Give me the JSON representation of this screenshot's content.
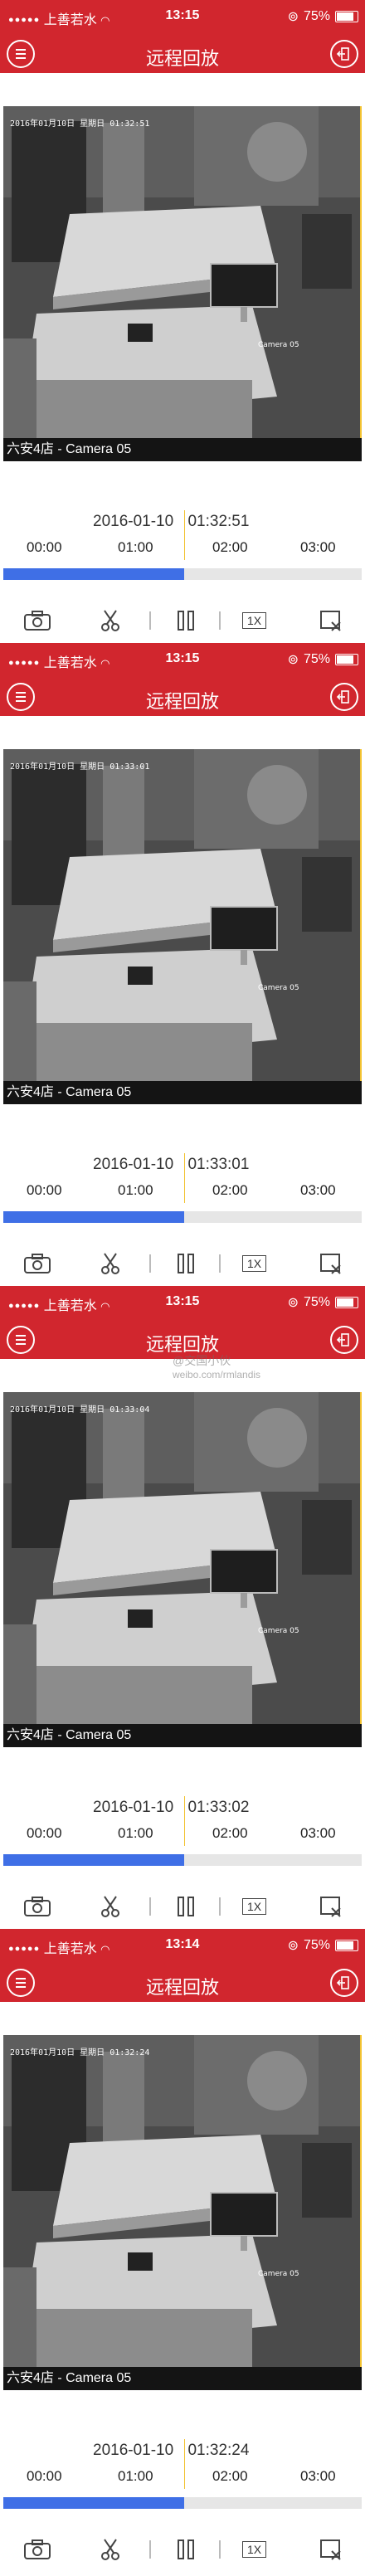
{
  "status_bar": {
    "carrier": "上善若水",
    "battery": "75%"
  },
  "header": {
    "title": "远程回放"
  },
  "camera_caption": "六安4店 - Camera 05",
  "timeline_ticks": [
    "00:00",
    "01:00",
    "02:00",
    "03:00"
  ],
  "playback_speed": "1X",
  "panels": [
    {
      "status_time": "13:15",
      "osd_timestamp": "2016年01月10日 星期日 01:32:51",
      "date": "2016-01-10",
      "time": "01:32:51",
      "progress_fraction": 0.505
    },
    {
      "status_time": "13:15",
      "osd_timestamp": "2016年01月10日 星期日 01:33:01",
      "date": "2016-01-10",
      "time": "01:33:01",
      "progress_fraction": 0.505
    },
    {
      "status_time": "13:15",
      "osd_timestamp": "2016年01月10日 星期日 01:33:04",
      "date": "2016-01-10",
      "time": "01:33:02",
      "progress_fraction": 0.505
    },
    {
      "status_time": "13:14",
      "osd_timestamp": "2016年01月10日 星期日 01:32:24",
      "date": "2016-01-10",
      "time": "01:32:24",
      "progress_fraction": 0.505
    }
  ],
  "watermark": {
    "line1": "@交国小伙",
    "line2": "weibo.com/rmlandis"
  },
  "colors": {
    "header_red": "#d1262e",
    "progress_blue": "#3f6fe6",
    "timeline_marker": "#f2c230"
  }
}
